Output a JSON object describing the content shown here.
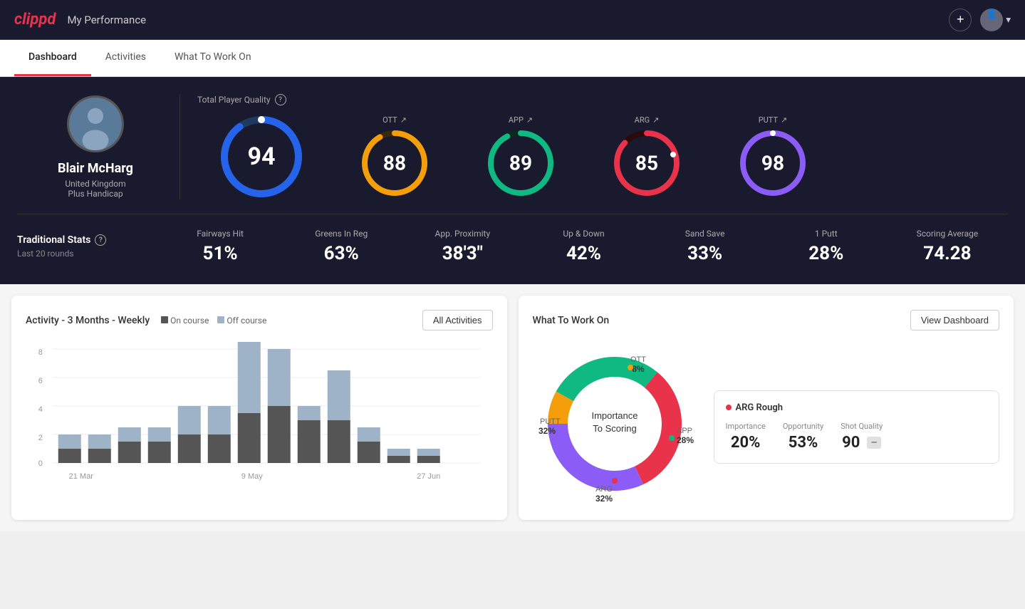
{
  "header": {
    "logo": "clippd",
    "title": "My Performance",
    "add_icon": "+",
    "avatar_chevron": "▾"
  },
  "nav": {
    "tabs": [
      {
        "label": "Dashboard",
        "active": true
      },
      {
        "label": "Activities",
        "active": false
      },
      {
        "label": "What To Work On",
        "active": false
      }
    ]
  },
  "hero": {
    "player": {
      "name": "Blair McHarg",
      "country": "United Kingdom",
      "handicap": "Plus Handicap"
    },
    "total_quality": {
      "label": "Total Player Quality",
      "value": 94,
      "color": "#2563eb"
    },
    "scores": [
      {
        "label": "OTT",
        "value": 88,
        "color": "#f59e0b",
        "trend": "↗"
      },
      {
        "label": "APP",
        "value": 89,
        "color": "#10b981",
        "trend": "↗"
      },
      {
        "label": "ARG",
        "value": 85,
        "color": "#e8334a",
        "trend": "↗"
      },
      {
        "label": "PUTT",
        "value": 98,
        "color": "#8b5cf6",
        "trend": "↗"
      }
    ],
    "traditional_stats": {
      "label": "Traditional Stats",
      "sub": "Last 20 rounds",
      "items": [
        {
          "name": "Fairways Hit",
          "value": "51%"
        },
        {
          "name": "Greens In Reg",
          "value": "63%"
        },
        {
          "name": "App. Proximity",
          "value": "38'3\""
        },
        {
          "name": "Up & Down",
          "value": "42%"
        },
        {
          "name": "Sand Save",
          "value": "33%"
        },
        {
          "name": "1 Putt",
          "value": "28%"
        },
        {
          "name": "Scoring Average",
          "value": "74.28"
        }
      ]
    }
  },
  "activity_chart": {
    "title": "Activity - 3 Months - Weekly",
    "legend": [
      {
        "label": "On course",
        "color": "#555"
      },
      {
        "label": "Off course",
        "color": "#9eb3c7"
      }
    ],
    "button": "All Activities",
    "y_axis": [
      "8",
      "6",
      "4",
      "2",
      "0"
    ],
    "x_labels": [
      "21 Mar",
      "9 May",
      "27 Jun"
    ],
    "bars": [
      {
        "on": 1,
        "off": 1
      },
      {
        "on": 1,
        "off": 1
      },
      {
        "on": 1.5,
        "off": 1
      },
      {
        "on": 1.5,
        "off": 1
      },
      {
        "on": 2,
        "off": 2
      },
      {
        "on": 2,
        "off": 2
      },
      {
        "on": 3.5,
        "off": 5
      },
      {
        "on": 4,
        "off": 4
      },
      {
        "on": 3,
        "off": 1
      },
      {
        "on": 3,
        "off": 3.5
      },
      {
        "on": 1.5,
        "off": 1
      },
      {
        "on": 0.5,
        "off": 0.5
      },
      {
        "on": 0.5,
        "off": 0.5
      }
    ]
  },
  "work_on": {
    "title": "What To Work On",
    "button": "View Dashboard",
    "donut": {
      "center_text": "Importance\nTo Scoring",
      "segments": [
        {
          "label": "OTT",
          "value": 8,
          "color": "#f59e0b",
          "position": "top"
        },
        {
          "label": "APP",
          "value": 28,
          "color": "#10b981",
          "position": "right"
        },
        {
          "label": "ARG",
          "value": 32,
          "color": "#e8334a",
          "position": "bottom"
        },
        {
          "label": "PUTT",
          "value": 32,
          "color": "#8b5cf6",
          "position": "left"
        }
      ]
    },
    "metric": {
      "title": "ARG Rough",
      "dot_color": "#e8334a",
      "cols": [
        {
          "label": "Importance",
          "value": "20%"
        },
        {
          "label": "Opportunity",
          "value": "53%"
        },
        {
          "label": "Shot Quality",
          "value": "90",
          "badge": ""
        }
      ]
    }
  }
}
